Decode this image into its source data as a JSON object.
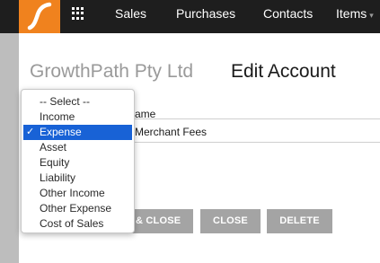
{
  "topbar": {
    "nav": {
      "sales": "Sales",
      "purchases": "Purchases",
      "contacts": "Contacts",
      "items": "Items"
    },
    "items_caret": "▾",
    "logo_color": "#f0821e"
  },
  "page": {
    "company": "GrowthPath Pty Ltd",
    "title": "Edit Account"
  },
  "form": {
    "field_label_partial": "ame",
    "field_value_partial": "Merchant Fees"
  },
  "buttons": {
    "save_close_partial": "& CLOSE",
    "close": "CLOSE",
    "delete": "DELETE"
  },
  "dropdown": {
    "selected": "Expense",
    "check": "✓",
    "options": [
      "-- Select --",
      "Income",
      "Expense",
      "Asset",
      "Equity",
      "Liability",
      "Other Income",
      "Other Expense",
      "Cost of Sales"
    ]
  },
  "colors": {
    "accent": "#f0821e",
    "topbar": "#1e1e1e",
    "selection": "#1862d6",
    "button": "#a4a4a4"
  }
}
